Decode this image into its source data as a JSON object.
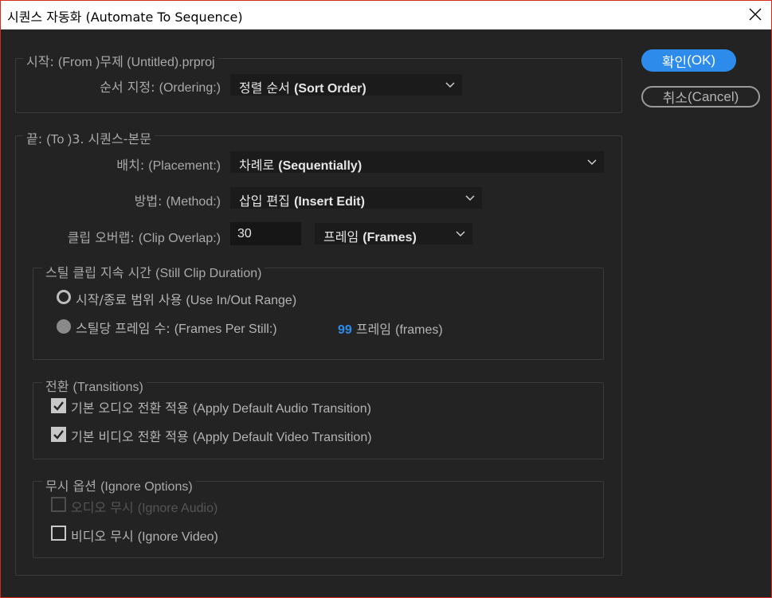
{
  "window": {
    "title": "시퀀스 자동화 (Automate To Sequence)"
  },
  "from_group": {
    "label_ko": "시작: ",
    "label_en": "(From )",
    "source_ko": "무제",
    "source_en": " (Untitled).prproj",
    "ordering_label_ko": "순서 지정: ",
    "ordering_label_en": "(Ordering:)",
    "ordering_value_ko": "정렬 순서 ",
    "ordering_value_en": "(Sort Order)"
  },
  "to_group": {
    "label_ko": "끝: ",
    "label_en": "(To )",
    "target": "3. 시퀀스-본문",
    "placement_label_ko": "배치: ",
    "placement_label_en": "(Placement:)",
    "placement_value_ko": "차례로 ",
    "placement_value_en": "(Sequentially)",
    "method_label_ko": "방법: ",
    "method_label_en": "(Method:)",
    "method_value_ko": "삽입 편집 ",
    "method_value_en": "(Insert Edit)",
    "overlap_label_ko": "클립 오버랩: ",
    "overlap_label_en": "(Clip Overlap:)",
    "overlap_value": "30",
    "overlap_unit_ko": "프레임 ",
    "overlap_unit_en": "(Frames)"
  },
  "still_clip": {
    "label_ko": "스틸 클립 지속 시간 ",
    "label_en": "(Still Clip Duration)",
    "use_in_out_ko": "시작/종료 범위 사용 ",
    "use_in_out_en": "(Use In/Out Range)",
    "per_still_ko": "스틸당 프레임 수: ",
    "per_still_en": "(Frames Per Still:)",
    "frames_value": "99",
    "frames_unit_ko": " 프레임 ",
    "frames_unit_en": "(frames)"
  },
  "transitions": {
    "label_ko": "전환 ",
    "label_en": "(Transitions)",
    "audio_ko": "기본 오디오 전환 적용 ",
    "audio_en": "(Apply Default Audio Transition)",
    "video_ko": "기본 비디오 전환 적용 ",
    "video_en": "(Apply Default Video Transition)"
  },
  "ignore": {
    "label_ko": "무시 옵션 ",
    "label_en": "(Ignore Options)",
    "audio_ko": "오디오 무시 ",
    "audio_en": "(Ignore Audio)",
    "video_ko": "비디오 무시 ",
    "video_en": "(Ignore Video)"
  },
  "buttons": {
    "ok_ko": "확인 ",
    "ok_en": "(OK)",
    "cancel_ko": "취소 ",
    "cancel_en": "(Cancel)"
  },
  "colors": {
    "accent": "#2d8ceb",
    "background": "#232323",
    "border": "#d42c1c"
  }
}
